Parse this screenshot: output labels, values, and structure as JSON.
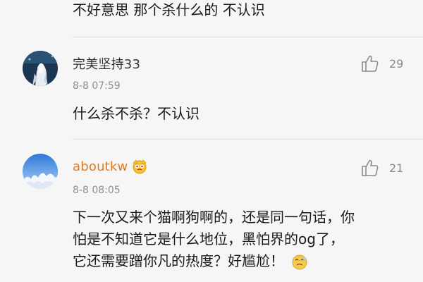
{
  "prev_comment": {
    "text": "不好意思 那个杀什么的 不认识"
  },
  "comments": [
    {
      "username": "完美坚持33",
      "timestamp": "8-8 07:59",
      "likes": "29",
      "text": "什么杀不杀？不认识"
    },
    {
      "username": "aboutkw",
      "timestamp": "8-8 08:05",
      "likes": "21",
      "lines": [
        "下一次又来个猫啊狗啊的，还是同一句话，你",
        "怕是不知道它是什么地位，黑怕界的og了，",
        "它还需要蹭你凡的热度？好尴尬！"
      ]
    }
  ],
  "icons": {
    "like": "thumbs-up-icon",
    "badge": "emoji-badge-icon",
    "emoji": "embarrassed-emoji-icon"
  },
  "colors": {
    "background": "#f6f6f6",
    "username_default": "#333333",
    "username_vip": "#e07a1f",
    "meta": "#8f8f8f"
  }
}
